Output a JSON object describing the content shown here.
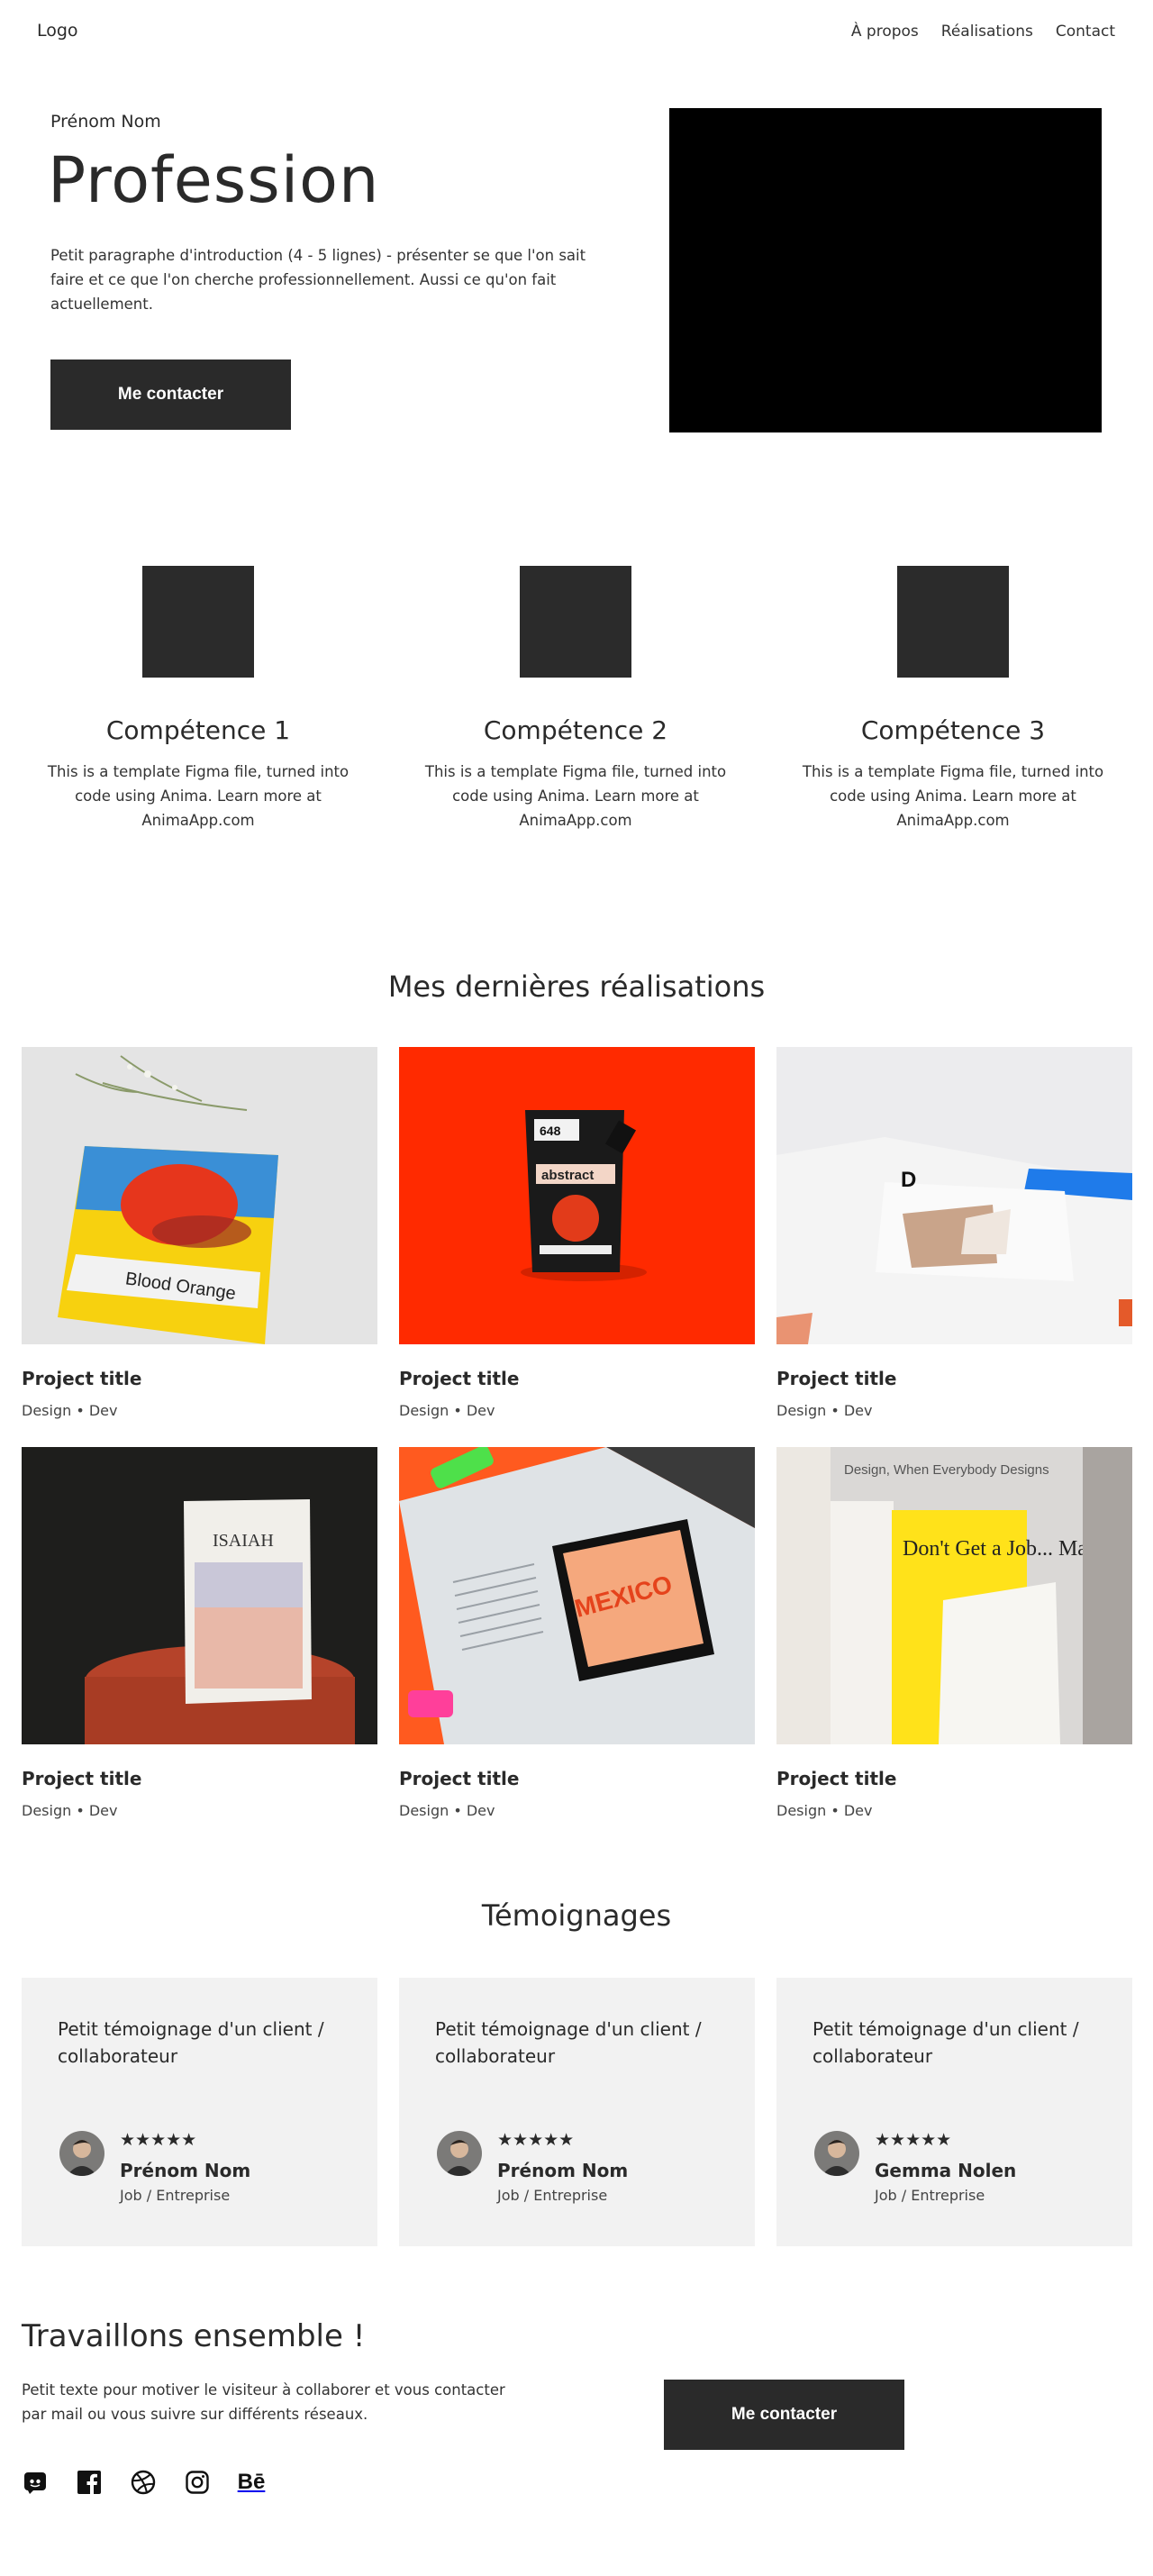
{
  "header": {
    "logo": "Logo",
    "nav": [
      "À propos",
      "Réalisations",
      "Contact"
    ]
  },
  "hero": {
    "name": "Prénom Nom",
    "title": "Profession",
    "intro": "Petit paragraphe d'introduction (4 - 5 lignes) - présenter se que l'on sait faire et ce que l'on cherche professionnellement. Aussi ce qu'on fait actuellement.",
    "cta": "Me contacter"
  },
  "skills": [
    {
      "title": "Compétence 1",
      "desc": "This is a template Figma file, turned into code using Anima. Learn more at AnimaApp.com"
    },
    {
      "title": "Compétence 2",
      "desc": "This is a template Figma file, turned into code using Anima. Learn more at AnimaApp.com"
    },
    {
      "title": "Compétence 3",
      "desc": "This is a template Figma file, turned into code using Anima. Learn more at AnimaApp.com"
    }
  ],
  "projects_section": {
    "title": "Mes dernières réalisations",
    "items": [
      {
        "title": "Project title",
        "tags": "Design • Dev",
        "image_text": "Blood Orange"
      },
      {
        "title": "Project title",
        "tags": "Design • Dev",
        "image_text": "abstract"
      },
      {
        "title": "Project title",
        "tags": "Design • Dev",
        "image_text": "D"
      },
      {
        "title": "Project title",
        "tags": "Design • Dev",
        "image_text": "ISAIAH"
      },
      {
        "title": "Project title",
        "tags": "Design • Dev",
        "image_text": "MEXICO"
      },
      {
        "title": "Project title",
        "tags": "Design • Dev",
        "image_text": "Don't Get a Job... Make a Job"
      }
    ]
  },
  "testimonials": {
    "title": "Témoignages",
    "items": [
      {
        "quote": "Petit témoignage d'un client / collaborateur",
        "stars": "★★★★★",
        "name": "Prénom Nom",
        "job": "Job / Entreprise"
      },
      {
        "quote": "Petit témoignage d'un client / collaborateur",
        "stars": "★★★★★",
        "name": "Prénom Nom",
        "job": "Job / Entreprise"
      },
      {
        "quote": "Petit témoignage d'un client / collaborateur",
        "stars": "★★★★★",
        "name": "Gemma Nolen",
        "job": "Job / Entreprise"
      }
    ]
  },
  "contact": {
    "title": "Travaillons ensemble !",
    "text": "Petit texte pour motiver le visiteur à collaborer et vous contacter par mail ou vous suivre sur différents réseaux.",
    "cta": "Me contacter",
    "socials": [
      "discord-icon",
      "facebook-icon",
      "dribbble-icon",
      "instagram-icon",
      "behance-icon"
    ],
    "behance_label": "Bē"
  }
}
